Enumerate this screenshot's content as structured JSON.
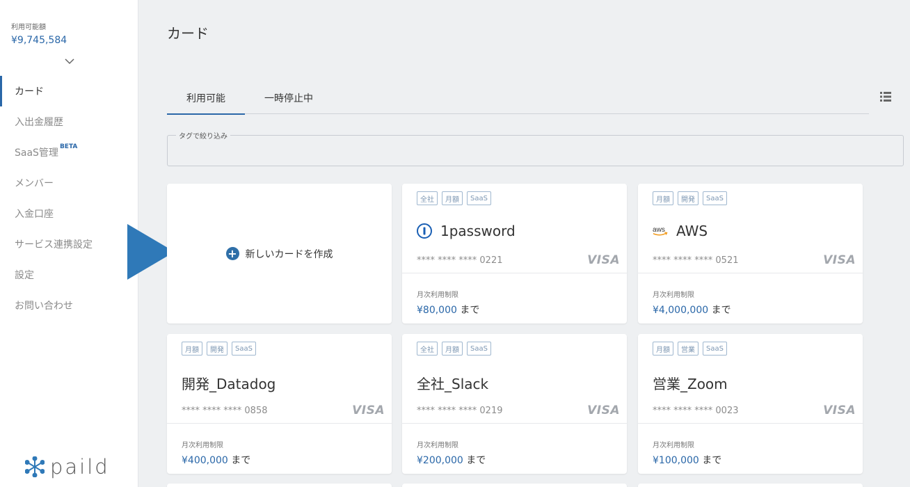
{
  "sidebar": {
    "balance_label": "利用可能額",
    "balance_value": "¥9,745,584",
    "nav": [
      {
        "label": "カード",
        "active": true
      },
      {
        "label": "入出金履歴",
        "active": false
      },
      {
        "label": "SaaS管理",
        "badge": "BETA",
        "active": false
      },
      {
        "label": "メンバー",
        "active": false
      },
      {
        "label": "入金口座",
        "active": false
      },
      {
        "label": "サービス連携設定",
        "active": false
      },
      {
        "label": "設定",
        "active": false
      },
      {
        "label": "お問い合わせ",
        "active": false
      }
    ],
    "logo_text": "paild"
  },
  "main": {
    "title": "カード",
    "tabs": [
      {
        "label": "利用可能",
        "active": true
      },
      {
        "label": "一時停止中",
        "active": false
      }
    ],
    "filter_label": "タグで絞り込み",
    "new_card_label": "新しいカードを作成",
    "cards": [
      {
        "tags": [
          "全社",
          "月額",
          "SaaS"
        ],
        "name": "1password",
        "icon": "1password-icon",
        "number": "**** **** **** 0221",
        "brand": "VISA",
        "limit_label": "月次利用制限",
        "limit_amount": "¥80,000",
        "limit_suffix": "まで"
      },
      {
        "tags": [
          "月額",
          "開発",
          "SaaS"
        ],
        "name": "AWS",
        "icon": "aws-icon",
        "number": "**** **** **** 0521",
        "brand": "VISA",
        "limit_label": "月次利用制限",
        "limit_amount": "¥4,000,000",
        "limit_suffix": "まで"
      },
      {
        "tags": [
          "月額",
          "開発",
          "SaaS"
        ],
        "name": "開発_Datadog",
        "icon": "",
        "number": "**** **** **** 0858",
        "brand": "VISA",
        "limit_label": "月次利用制限",
        "limit_amount": "¥400,000",
        "limit_suffix": "まで"
      },
      {
        "tags": [
          "全社",
          "月額",
          "SaaS"
        ],
        "name": "全社_Slack",
        "icon": "",
        "number": "**** **** **** 0219",
        "brand": "VISA",
        "limit_label": "月次利用制限",
        "limit_amount": "¥200,000",
        "limit_suffix": "まで"
      },
      {
        "tags": [
          "月額",
          "営業",
          "SaaS"
        ],
        "name": "営業_Zoom",
        "icon": "",
        "number": "**** **** **** 0023",
        "brand": "VISA",
        "limit_label": "月次利用制限",
        "limit_amount": "¥100,000",
        "limit_suffix": "まで"
      }
    ]
  },
  "colors": {
    "accent": "#2a67a8",
    "pointer": "#2f79b8",
    "background": "#eef0f2"
  }
}
